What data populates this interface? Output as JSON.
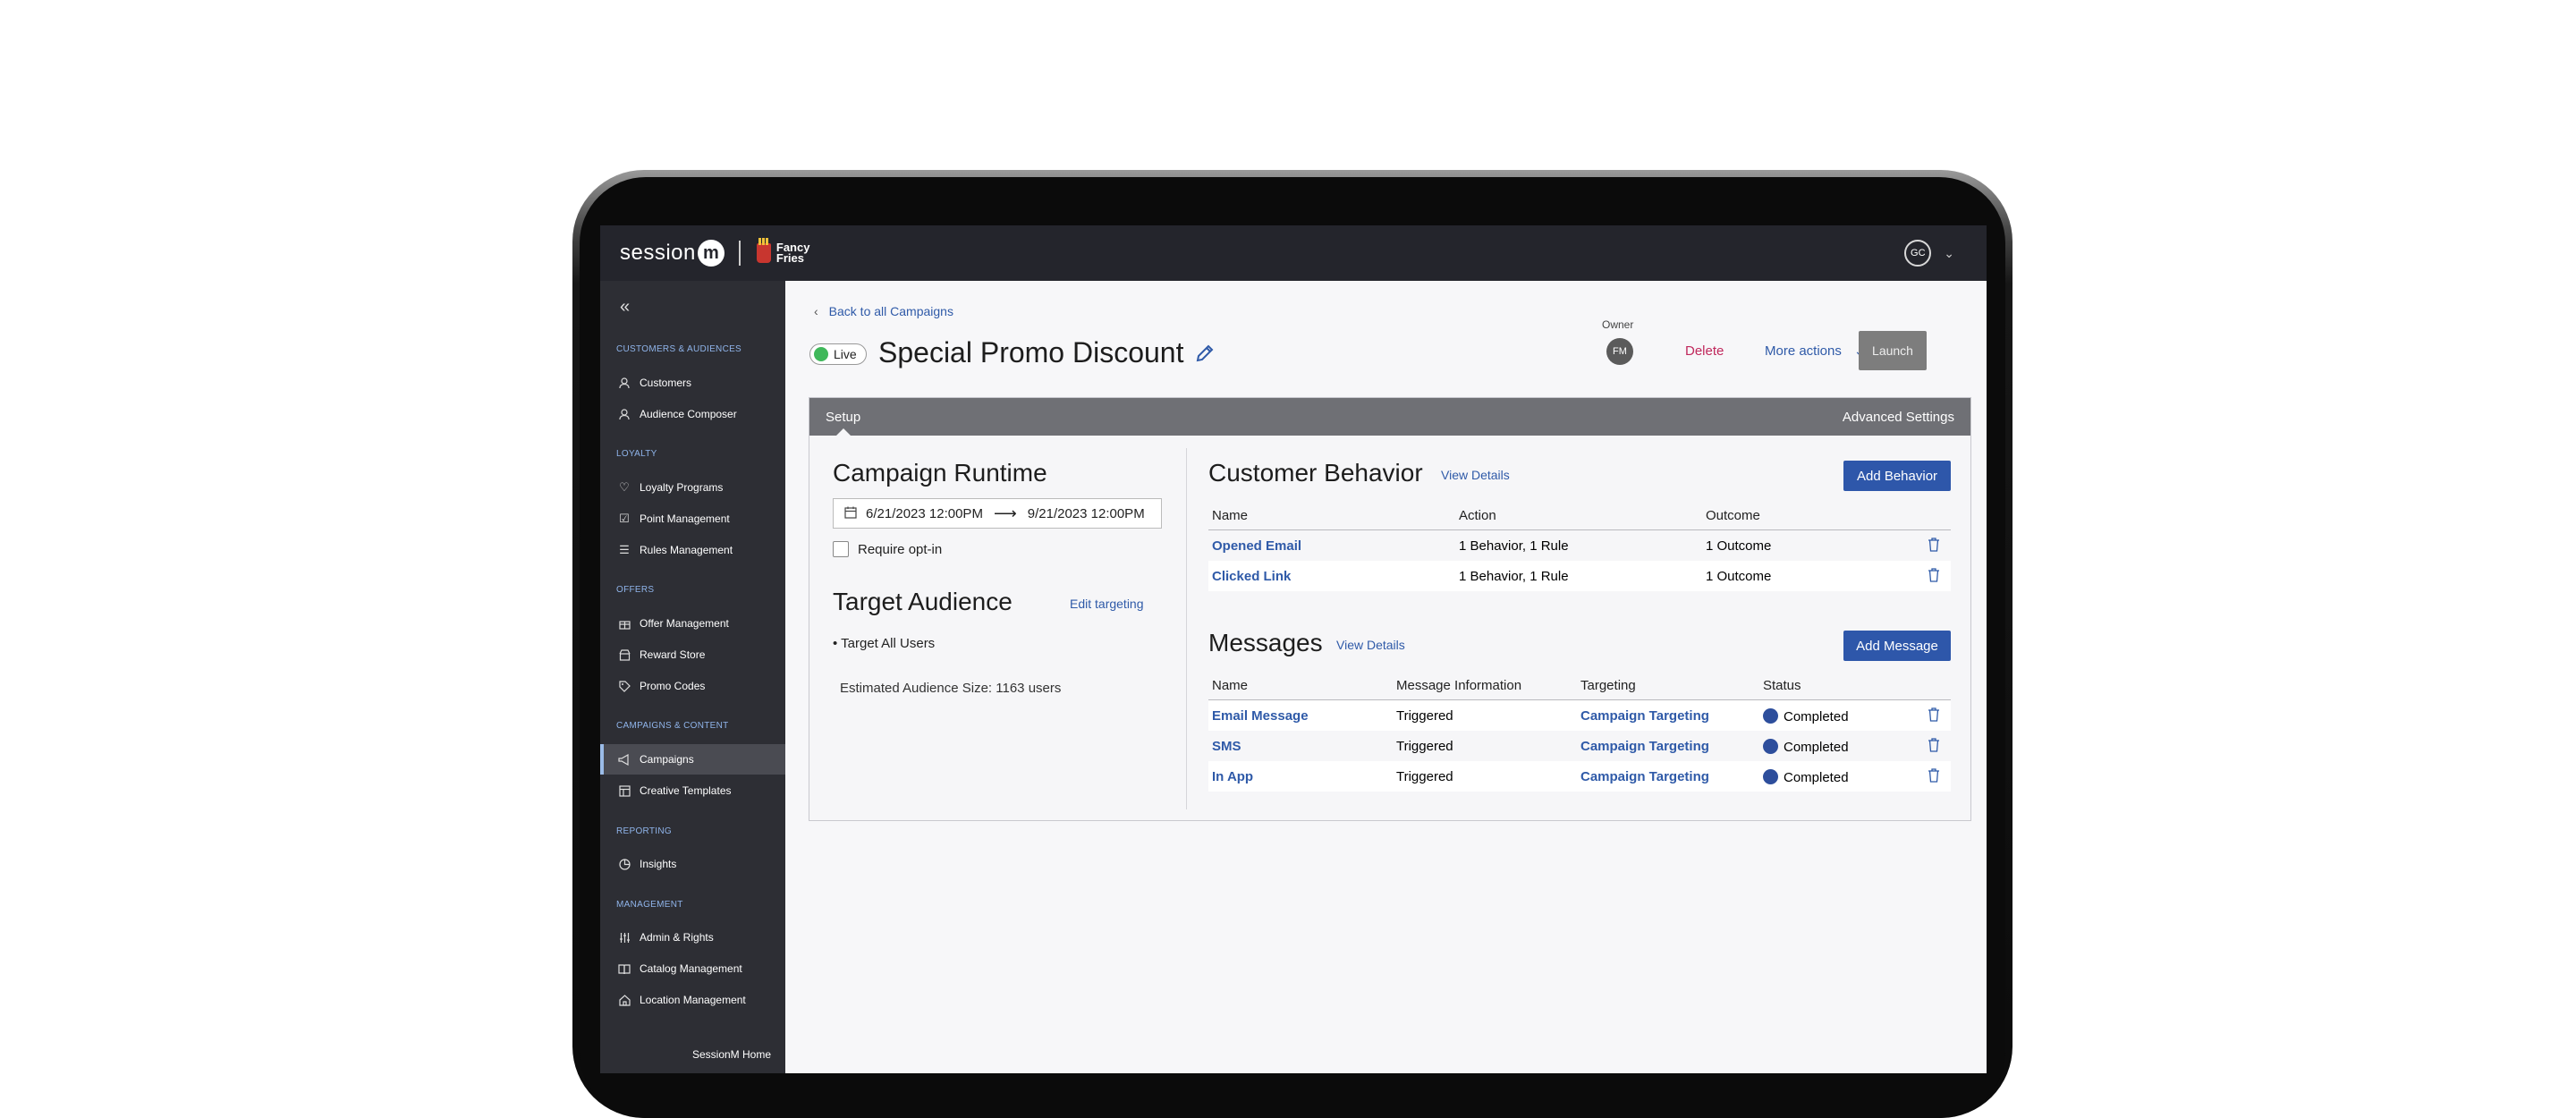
{
  "topbar": {
    "brand_session": "session",
    "brand_m": "m",
    "client_name": "Fancy Fries",
    "user_initials": "GC"
  },
  "sidebar": {
    "sections": [
      {
        "label": "CUSTOMERS & AUDIENCES",
        "items": [
          {
            "label": "Customers",
            "icon": "user-icon"
          },
          {
            "label": "Audience Composer",
            "icon": "user-icon"
          }
        ]
      },
      {
        "label": "LOYALTY",
        "items": [
          {
            "label": "Loyalty Programs",
            "icon": "heart-icon"
          },
          {
            "label": "Point Management",
            "icon": "checklist-icon"
          },
          {
            "label": "Rules Management",
            "icon": "list-icon"
          }
        ]
      },
      {
        "label": "OFFERS",
        "items": [
          {
            "label": "Offer Management",
            "icon": "gift-icon"
          },
          {
            "label": "Reward Store",
            "icon": "store-icon"
          },
          {
            "label": "Promo Codes",
            "icon": "tag-icon"
          }
        ]
      },
      {
        "label": "CAMPAIGNS & CONTENT",
        "items": [
          {
            "label": "Campaigns",
            "icon": "megaphone-icon"
          },
          {
            "label": "Creative Templates",
            "icon": "template-icon"
          }
        ]
      },
      {
        "label": "REPORTING",
        "items": [
          {
            "label": "Insights",
            "icon": "pie-chart-icon"
          }
        ]
      },
      {
        "label": "MANAGEMENT",
        "items": [
          {
            "label": "Admin & Rights",
            "icon": "sliders-icon"
          },
          {
            "label": "Catalog Management",
            "icon": "book-icon"
          },
          {
            "label": "Location Management",
            "icon": "home-icon"
          }
        ]
      }
    ],
    "active": "Campaigns",
    "home_label": "SessionM Home"
  },
  "header": {
    "back_label": "Back to all Campaigns",
    "status": "Live",
    "title": "Special Promo Discount",
    "owner_label": "Owner",
    "owner_initials": "FM",
    "delete_label": "Delete",
    "more_actions_label": "More actions",
    "launch_label": "Launch"
  },
  "tabs": {
    "setup": "Setup",
    "advanced": "Advanced Settings"
  },
  "runtime": {
    "title": "Campaign Runtime",
    "start": "6/21/2023 12:00PM",
    "end": "9/21/2023 12:00PM",
    "optin_label": "Require opt-in"
  },
  "audience": {
    "title": "Target Audience",
    "edit_label": "Edit targeting",
    "target": "• Target All Users",
    "size": "Estimated Audience Size: 1163 users"
  },
  "behavior": {
    "title": "Customer Behavior",
    "view_details": "View Details",
    "add_label": "Add Behavior",
    "columns": [
      "Name",
      "Action",
      "Outcome"
    ],
    "rows": [
      {
        "name": "Opened Email",
        "action": "1 Behavior, 1 Rule",
        "outcome": "1 Outcome"
      },
      {
        "name": "Clicked Link",
        "action": "1 Behavior, 1 Rule",
        "outcome": "1 Outcome"
      }
    ]
  },
  "messages": {
    "title": "Messages",
    "view_details": "View Details",
    "add_label": "Add Message",
    "columns": [
      "Name",
      "Message Information",
      "Targeting",
      "Status"
    ],
    "rows": [
      {
        "name": "Email Message",
        "info": "Triggered",
        "targeting": "Campaign Targeting",
        "status": "Completed"
      },
      {
        "name": "SMS",
        "info": "Triggered",
        "targeting": "Campaign Targeting",
        "status": "Completed"
      },
      {
        "name": "In App",
        "info": "Triggered",
        "targeting": "Campaign Targeting",
        "status": "Completed"
      }
    ]
  },
  "colors": {
    "accent": "#2e57aa",
    "live": "#3fb85a",
    "delete": "#c0285c",
    "sidebar": "#2d2e34"
  }
}
